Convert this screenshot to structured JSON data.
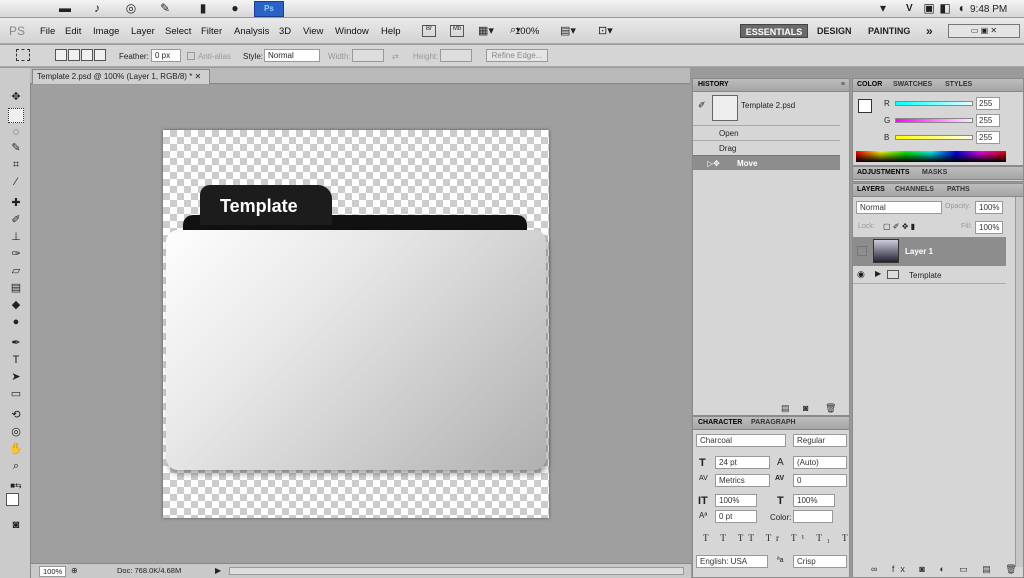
{
  "mac_bar": {
    "clock": "9:48 PM",
    "lang": "V"
  },
  "menubar": {
    "ps_logo": "PS",
    "items": [
      "File",
      "Edit",
      "Image",
      "Layer",
      "Select",
      "Filter",
      "Analysis",
      "3D",
      "View",
      "Window",
      "Help"
    ],
    "zoom": "100%",
    "workspaces": [
      "ESSENTIALS",
      "DESIGN",
      "PAINTING"
    ],
    "more": "»"
  },
  "options": {
    "feather_label": "Feather:",
    "feather_value": "0 px",
    "antialias": "Anti-alias",
    "style_label": "Style:",
    "style_value": "Normal",
    "width_label": "Width:",
    "height_label": "Height:",
    "refine": "Refine Edge..."
  },
  "document": {
    "tab_title": "Template 2.psd @ 100% (Layer 1, RGB/8) *",
    "folder_label": "Template"
  },
  "status": {
    "zoom": "100%",
    "doc": "Doc: 768.0K/4.68M"
  },
  "history": {
    "title": "HISTORY",
    "snapshot": "Template 2.psd",
    "steps": [
      "Open",
      "Drag",
      "Move"
    ]
  },
  "color_panel": {
    "tabs": [
      "COLOR",
      "SWATCHES",
      "STYLES"
    ],
    "channels": [
      {
        "name": "R",
        "value": "255",
        "color": "#22d0d0"
      },
      {
        "name": "G",
        "value": "255",
        "color": "#d020d0"
      },
      {
        "name": "B",
        "value": "255",
        "color": "#d0d020"
      }
    ]
  },
  "adjust_panel": {
    "tabs": [
      "ADJUSTMENTS",
      "MASKS"
    ]
  },
  "layers_panel": {
    "tabs": [
      "LAYERS",
      "CHANNELS",
      "PATHS"
    ],
    "blend": "Normal",
    "opacity_label": "Opacity:",
    "opacity": "100%",
    "lock_label": "Lock:",
    "fill_label": "Fill:",
    "fill": "100%",
    "layers": [
      "Layer 1",
      "Template"
    ]
  },
  "character": {
    "tabs": [
      "CHARACTER",
      "PARAGRAPH"
    ],
    "font": "Charcoal",
    "style": "Regular",
    "size": "24 pt",
    "leading": "(Auto)",
    "kerning": "Metrics",
    "tracking": "0",
    "vscale": "100%",
    "hscale": "100%",
    "baseline": "0 pt",
    "color_label": "Color:",
    "language": "English: USA",
    "aa": "Crisp"
  }
}
